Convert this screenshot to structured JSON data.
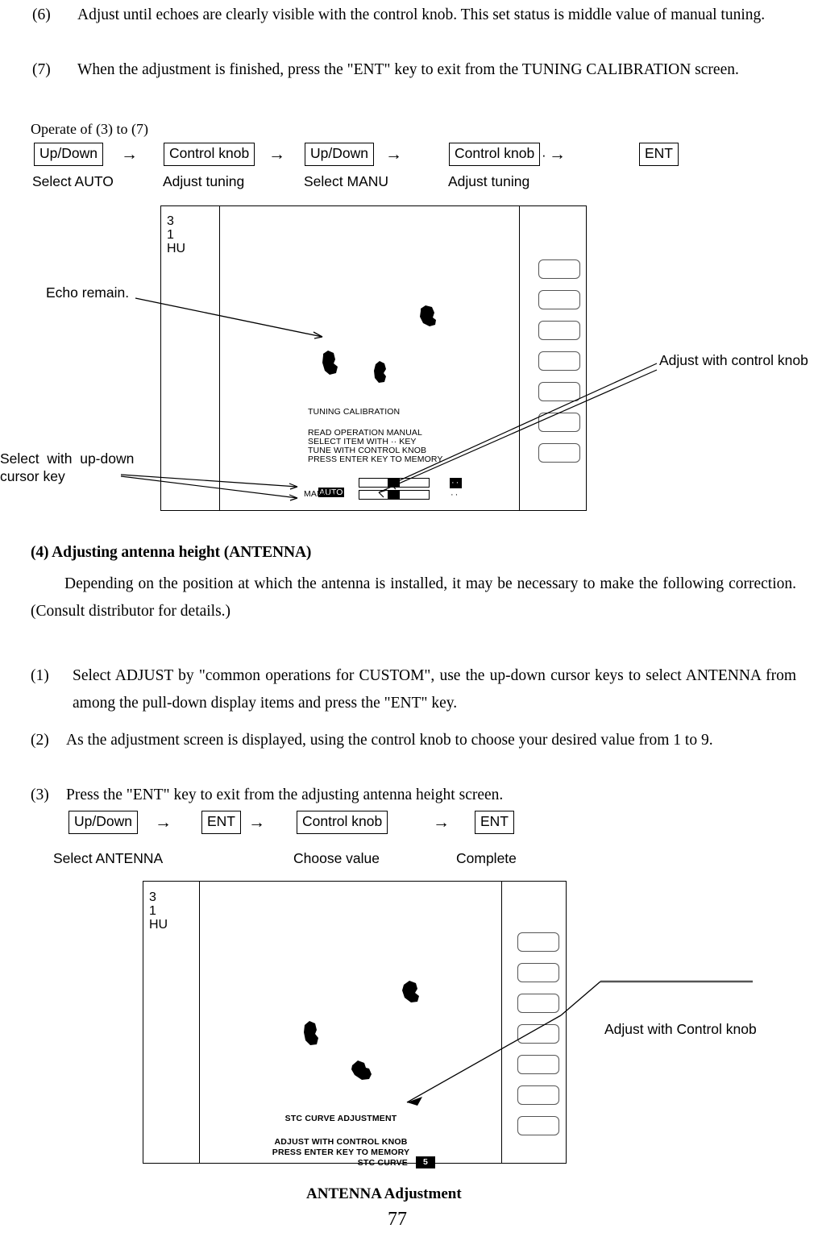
{
  "document": {
    "footer_title": "ANTENNA Adjustment",
    "page_number": "77"
  },
  "steps_top": [
    {
      "number": "(6)",
      "text": "Adjust until echoes are clearly visible with the control knob. This set status is middle value of manual tuning."
    },
    {
      "number": "(7)",
      "text": " When the adjustment is finished, press the \"ENT\" key to exit from the TUNING CALIBRATION screen."
    }
  ],
  "operation_flow_1": {
    "caption": "Operate of (3) to (7)",
    "keys": [
      {
        "label": "Up/Down",
        "sub": "Select AUTO"
      },
      {
        "label": "Control knob",
        "sub": "Adjust tuning"
      },
      {
        "label": "Up/Down",
        "sub": "Select MANU"
      },
      {
        "label": "Control knob",
        "sub": "Adjust tuning"
      },
      {
        "label": "ENT",
        "sub": ""
      }
    ],
    "arrow": "→",
    "dot": "·"
  },
  "diagram_1": {
    "corner_id": "3\n1\nHU",
    "osd_title": "TUNING CALIBRATION",
    "osd_lines": [
      "READ OPERATION MANUAL",
      "SELECT ITEM WITH ·· KEY",
      "TUNE WITH CONTROL KNOB",
      "PRESS ENTER KEY TO MEMORY"
    ],
    "rows": [
      {
        "label": "AUTO",
        "selected": true,
        "dots": "··",
        "dots_inverted": true
      },
      {
        "label": "MANUAL",
        "selected": false,
        "dots": "··",
        "dots_inverted": false
      }
    ],
    "callouts": {
      "echo": "Echo remain.",
      "cursor": "Select  with  up-down\ncursor key",
      "knob": "Adjust with control knob"
    }
  },
  "section": {
    "heading": "(4) Adjusting antenna height (ANTENNA)",
    "intro": "Depending on the position at which the antenna is installed, it may be necessary to make the following correction. (Consult distributor for details.)"
  },
  "steps_bottom": [
    {
      "number": "(1)",
      "text": " Select ADJUST by \"common operations for CUSTOM\", use the up-down cursor keys to select ANTENNA from among the pull-down display items and press the \"ENT\" key."
    },
    {
      "number": "(2)",
      "text": "As the adjustment screen is displayed, using the control knob to choose your desired value from 1 to 9."
    },
    {
      "number": "(3)",
      "text": "Press the \"ENT\" key to exit from the adjusting antenna height screen."
    }
  ],
  "operation_flow_2": {
    "keys": [
      {
        "label": "Up/Down",
        "sub": "Select ANTENNA"
      },
      {
        "label": "ENT",
        "sub": ""
      },
      {
        "label": "Control knob",
        "sub": "Choose value"
      },
      {
        "label": "ENT",
        "sub": "Complete"
      }
    ],
    "arrow": "→"
  },
  "diagram_2": {
    "corner_id": "3\n1\nHU",
    "osd_title": "STC CURVE ADJUSTMENT",
    "osd_lines": [
      "ADJUST WITH CONTROL KNOB",
      "PRESS ENTER KEY TO MEMORY"
    ],
    "value_label": "STC CURVE",
    "value": "5",
    "callouts": {
      "knob": "Adjust with Control knob"
    }
  },
  "colors": {
    "ink": "#000000",
    "paper": "#ffffff",
    "softkey_border": "#555555"
  }
}
